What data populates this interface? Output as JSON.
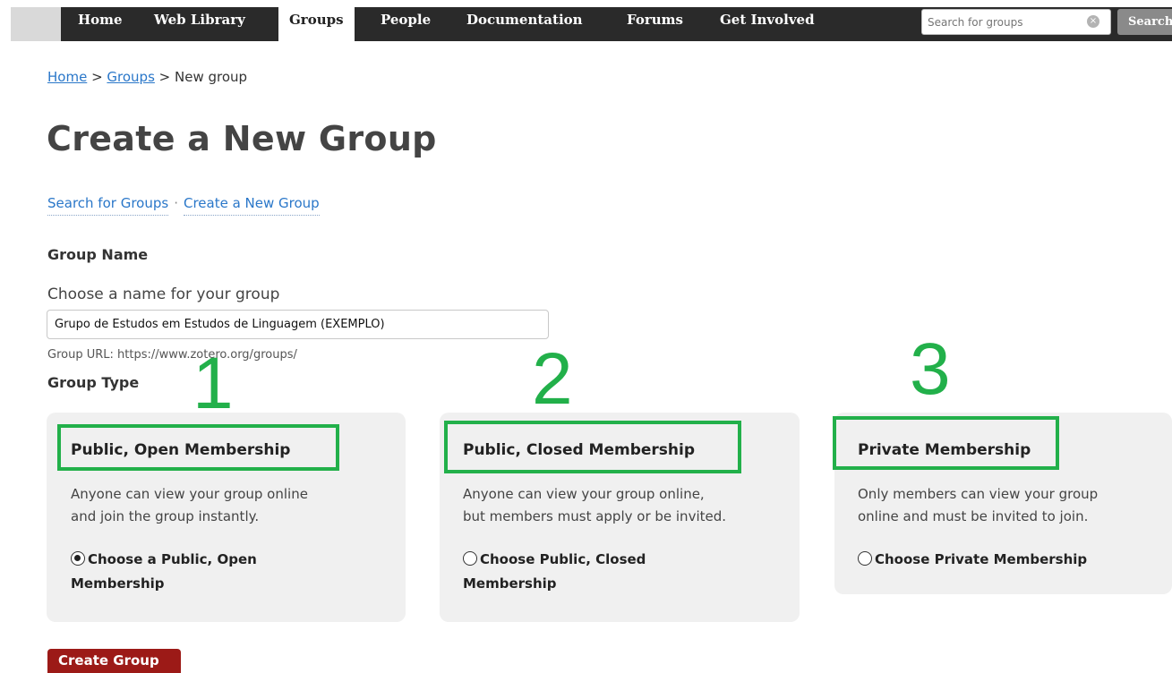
{
  "nav": {
    "items": [
      "Home",
      "Web Library",
      "Groups",
      "People",
      "Documentation",
      "Forums",
      "Get Involved"
    ],
    "active": "Groups",
    "search_placeholder": "Search for groups",
    "search_button": "Search"
  },
  "breadcrumb": {
    "home": "Home",
    "sep1": " > ",
    "groups": "Groups",
    "sep2": " > ",
    "current": "New group"
  },
  "page_title": "Create a New Group",
  "subnav": {
    "search": "Search for Groups",
    "separator": "·",
    "create": "Create a New Group"
  },
  "form": {
    "group_name_heading": "Group Name",
    "name_label": "Choose a name for your group",
    "name_value": "Grupo de Estudos em Estudos de Linguagem (EXEMPLO)",
    "group_url": "Group URL: https://www.zotero.org/groups/",
    "group_type_heading": "Group Type",
    "create_button": "Create Group"
  },
  "group_types": [
    {
      "title": "Public, Open Membership",
      "desc_line1": "Anyone can view your group online",
      "desc_line2": "and join the group instantly.",
      "option_line1": "Choose a Public, Open",
      "option_line2": "Membership",
      "selected": true
    },
    {
      "title": "Public, Closed Membership",
      "desc_line1": "Anyone can view your group online,",
      "desc_line2": "but members must apply or be invited.",
      "option_line1": "Choose Public, Closed",
      "option_line2": "Membership",
      "selected": false
    },
    {
      "title": "Private Membership",
      "desc_line1": "Only members can view your group",
      "desc_line2": "online and must be invited to join.",
      "option_line1": "Choose Private Membership",
      "option_line2": "",
      "selected": false
    }
  ],
  "annotations": [
    "1",
    "2",
    "3"
  ],
  "colors": {
    "annotation": "#22b04a",
    "nav_background": "#2a2a2a",
    "link": "#2a77c9",
    "create_button": "#9c1a17"
  }
}
